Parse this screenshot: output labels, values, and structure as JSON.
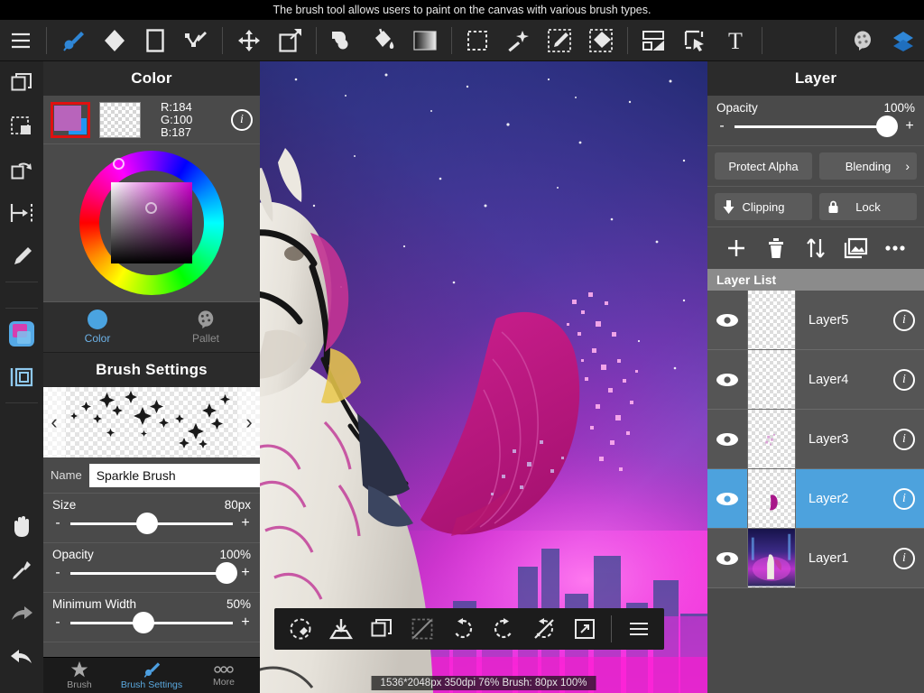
{
  "hint": {
    "text": "The brush tool allows users to paint on the canvas with various brush types."
  },
  "top_toolbar": {
    "items": [
      {
        "name": "menu-icon",
        "label": "Menu"
      },
      {
        "name": "brush-tool-icon",
        "label": "Brush"
      },
      {
        "name": "eraser-tool-icon",
        "label": "Eraser"
      },
      {
        "name": "shape-tool-icon",
        "label": "Shape"
      },
      {
        "name": "path-tool-icon",
        "label": "Path"
      },
      {
        "name": "move-tool-icon",
        "label": "Move"
      },
      {
        "name": "transform-tool-icon",
        "label": "Transform"
      },
      {
        "name": "blur-tool-icon",
        "label": "Blur"
      },
      {
        "name": "bucket-fill-icon",
        "label": "Bucket"
      },
      {
        "name": "gradient-tool-icon",
        "label": "Gradient"
      },
      {
        "name": "rect-select-icon",
        "label": "Select"
      },
      {
        "name": "magic-wand-icon",
        "label": "Auto Select"
      },
      {
        "name": "select-pen-icon",
        "label": "Select Pen"
      },
      {
        "name": "select-eraser-icon",
        "label": "Select Eraser"
      },
      {
        "name": "frame-divide-icon",
        "label": "Frame Divide"
      },
      {
        "name": "object-select-icon",
        "label": "Object"
      },
      {
        "name": "text-tool-icon",
        "label": "Text"
      },
      {
        "name": "palette-icon",
        "label": "Palette"
      },
      {
        "name": "layers-icon",
        "label": "Layers"
      }
    ]
  },
  "left_rail": {
    "items": [
      {
        "name": "rail-copy-icon",
        "label": "Copy"
      },
      {
        "name": "rail-select-fill-icon",
        "label": "Select Fill"
      },
      {
        "name": "rail-flip-icon",
        "label": "Flip"
      },
      {
        "name": "rail-align-icon",
        "label": "Align"
      },
      {
        "name": "rail-pen-icon",
        "label": "Pen"
      },
      {
        "name": "rail-color-icon",
        "label": "Color Panel"
      },
      {
        "name": "rail-layerpanel-icon",
        "label": "Layer Panel"
      },
      {
        "name": "rail-hand-icon",
        "label": "Hand"
      },
      {
        "name": "rail-eyedropper-icon",
        "label": "Eyedropper"
      },
      {
        "name": "rail-redo-icon",
        "label": "Redo"
      },
      {
        "name": "rail-undo-icon",
        "label": "Undo"
      }
    ]
  },
  "color_panel": {
    "title": "Color",
    "rgb_text": "R:184\nG:100\nB:187",
    "r": 184,
    "g": 100,
    "b": 187,
    "foreground_hex": "#b864bb",
    "background_hex": "#2196f3",
    "info_label": "i",
    "tabs": [
      {
        "name": "tab-color",
        "label": "Color",
        "active": true
      },
      {
        "name": "tab-pallet",
        "label": "Pallet",
        "active": false
      }
    ]
  },
  "brush_settings": {
    "title": "Brush Settings",
    "prev_label": "‹",
    "next_label": "›",
    "name_label": "Name",
    "name_value": "Sparkle Brush",
    "sliders": [
      {
        "name": "size",
        "label": "Size",
        "value_text": "80px",
        "percent": 47
      },
      {
        "name": "opacity",
        "label": "Opacity",
        "value_text": "100%",
        "percent": 100
      },
      {
        "name": "minimum-width",
        "label": "Minimum Width",
        "value_text": "50%",
        "percent": 45
      }
    ]
  },
  "bottom_tabs": [
    {
      "name": "bottom-tab-brush",
      "label": "Brush",
      "active": false
    },
    {
      "name": "bottom-tab-brush-settings",
      "label": "Brush Settings",
      "active": true
    },
    {
      "name": "bottom-tab-more",
      "label": "More",
      "active": false
    }
  ],
  "canvas_toolbar": {
    "items": [
      {
        "name": "reset-rotation-icon",
        "label": "Reset View"
      },
      {
        "name": "save-icon",
        "label": "Save"
      },
      {
        "name": "duplicate-icon",
        "label": "Duplicate"
      },
      {
        "name": "deselect-icon",
        "label": "Deselect"
      },
      {
        "name": "undo-icon",
        "label": "Undo"
      },
      {
        "name": "redo-icon",
        "label": "Redo"
      },
      {
        "name": "disable-rotate-icon",
        "label": "Lock Rotation"
      },
      {
        "name": "fullscreen-icon",
        "label": "Full Screen"
      },
      {
        "name": "canvas-menu-icon",
        "label": "Menu"
      }
    ]
  },
  "status_bar": {
    "text": "1536*2048px 350dpi 76% Brush: 80px 100%"
  },
  "layer_panel": {
    "title": "Layer",
    "opacity": {
      "label": "Opacity",
      "value_text": "100%",
      "percent": 100,
      "minus": "-",
      "plus": "+"
    },
    "buttons": [
      {
        "name": "protect-alpha-button",
        "label": "Protect Alpha",
        "has_chevron": false,
        "has_icon": false
      },
      {
        "name": "blending-button",
        "label": "Blending",
        "has_chevron": true,
        "has_icon": false
      },
      {
        "name": "clipping-button",
        "label": "Clipping",
        "has_chevron": false,
        "has_icon": true
      },
      {
        "name": "lock-button",
        "label": "Lock",
        "has_chevron": false,
        "has_icon": true
      }
    ],
    "ops": [
      {
        "name": "add-layer-icon",
        "label": "Add"
      },
      {
        "name": "delete-layer-icon",
        "label": "Delete"
      },
      {
        "name": "reorder-layer-icon",
        "label": "Reorder"
      },
      {
        "name": "import-image-icon",
        "label": "Import"
      },
      {
        "name": "more-options-icon",
        "label": "More"
      }
    ],
    "list_header": "Layer List",
    "layers": [
      {
        "name": "Layer5",
        "visible": true,
        "selected": false,
        "thumb": "empty",
        "info": "i"
      },
      {
        "name": "Layer4",
        "visible": true,
        "selected": false,
        "thumb": "empty",
        "info": "i"
      },
      {
        "name": "Layer3",
        "visible": true,
        "selected": false,
        "thumb": "sparkle",
        "info": "i"
      },
      {
        "name": "Layer2",
        "visible": true,
        "selected": true,
        "thumb": "wing",
        "info": "i"
      },
      {
        "name": "Layer1",
        "visible": true,
        "selected": false,
        "thumb": "photo",
        "info": "i"
      }
    ]
  },
  "theme": {
    "accent": "#4da2dd",
    "panel_bg": "#4a4a4a",
    "toolbar_bg": "#262626",
    "selection_red": "#e01010"
  }
}
